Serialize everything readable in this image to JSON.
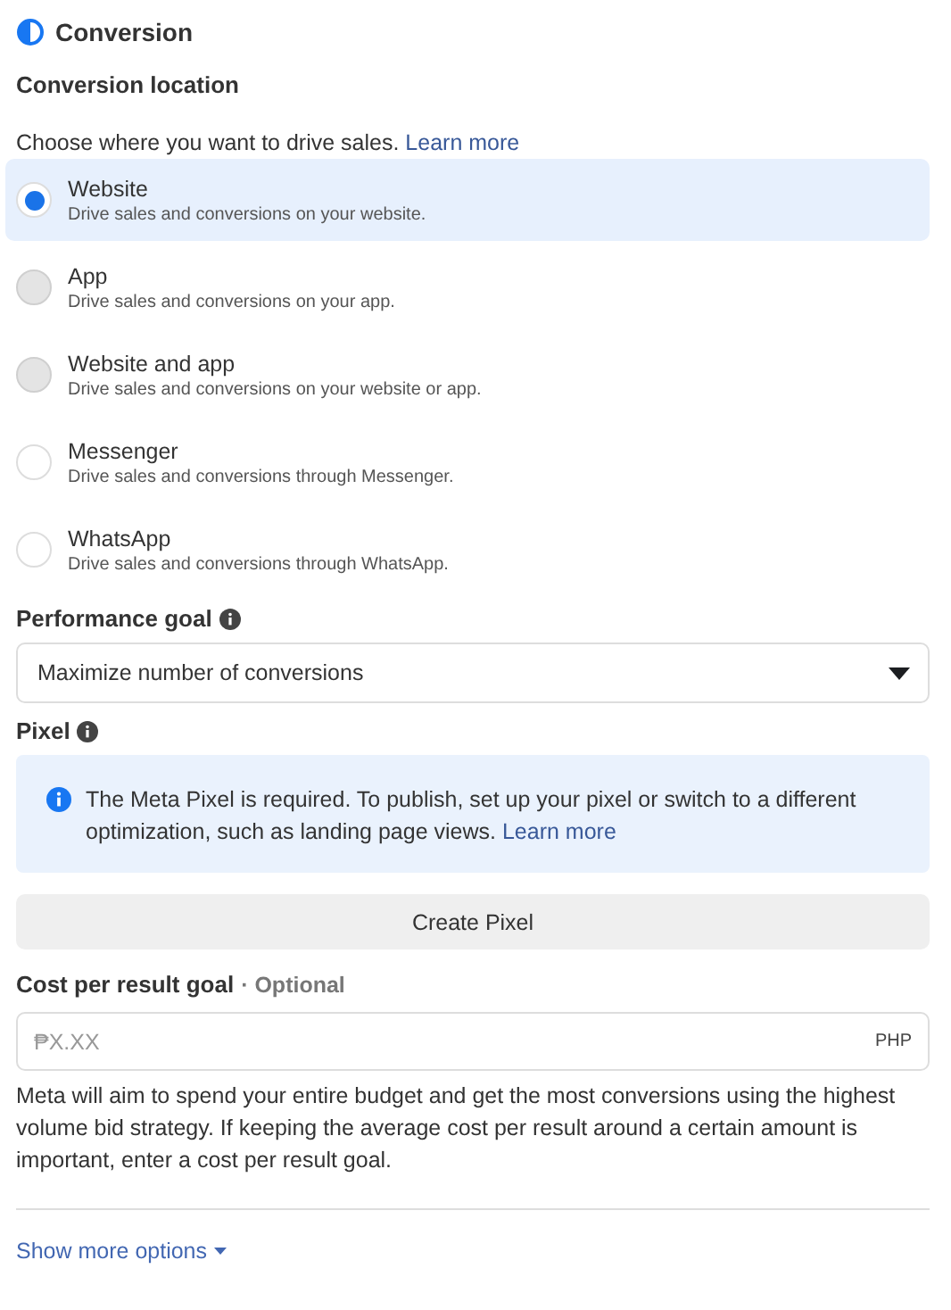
{
  "section": {
    "title": "Conversion"
  },
  "conversion_location": {
    "label": "Conversion location",
    "intro": "Choose where you want to drive sales.",
    "intro_link": "Learn more",
    "options": [
      {
        "title": "Website",
        "description": "Drive sales and conversions on your website.",
        "selected": true,
        "disabled": false
      },
      {
        "title": "App",
        "description": "Drive sales and conversions on your app.",
        "selected": false,
        "disabled": true
      },
      {
        "title": "Website and app",
        "description": "Drive sales and conversions on your website or app.",
        "selected": false,
        "disabled": true
      },
      {
        "title": "Messenger",
        "description": "Drive sales and conversions through Messenger.",
        "selected": false,
        "disabled": false
      },
      {
        "title": "WhatsApp",
        "description": "Drive sales and conversions through WhatsApp.",
        "selected": false,
        "disabled": false
      }
    ]
  },
  "performance_goal": {
    "label": "Performance goal",
    "value": "Maximize number of conversions"
  },
  "pixel": {
    "label": "Pixel",
    "notice": "The Meta Pixel is required. To publish, set up your pixel or switch to a different optimization, such as landing page views.",
    "notice_link": "Learn more",
    "button": "Create Pixel"
  },
  "cost_goal": {
    "label": "Cost per result goal",
    "optional": "· Optional",
    "placeholder": "₱X.XX",
    "currency": "PHP",
    "help": "Meta will aim to spend your entire budget and get the most conversions using the highest volume bid strategy. If keeping the average cost per result around a certain amount is important, enter a cost per result goal."
  },
  "show_more": "Show more options"
}
